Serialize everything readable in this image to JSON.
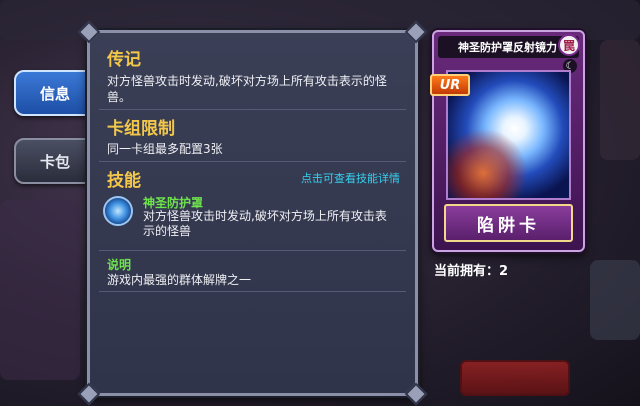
{
  "tabs": [
    {
      "label": "信息",
      "active": true
    },
    {
      "label": "卡包",
      "active": false
    }
  ],
  "panel": {
    "biography": {
      "title": "传记",
      "text": "对方怪兽攻击时发动,破坏对方场上所有攻击表示的怪兽。"
    },
    "deck_limit": {
      "title": "卡组限制",
      "text": "同一卡组最多配置3张"
    },
    "skills": {
      "title": "技能",
      "link_label": "点击可查看技能详情",
      "skill_name": "神圣防护罩",
      "skill_desc": "对方怪兽攻击时发动,破坏对方场上所有攻击表示的怪兽",
      "skill_icon": "shield-orb-icon"
    },
    "note": {
      "title": "说明",
      "text": "游戏内最强的群体解牌之一"
    }
  },
  "card": {
    "name": "神圣防护罩反射镜力",
    "attribute": "罠",
    "rarity": "UR",
    "type": "陷阱卡",
    "frame_color": "#6a2a7c"
  },
  "owned": {
    "label": "当前拥有：",
    "count": "2"
  }
}
